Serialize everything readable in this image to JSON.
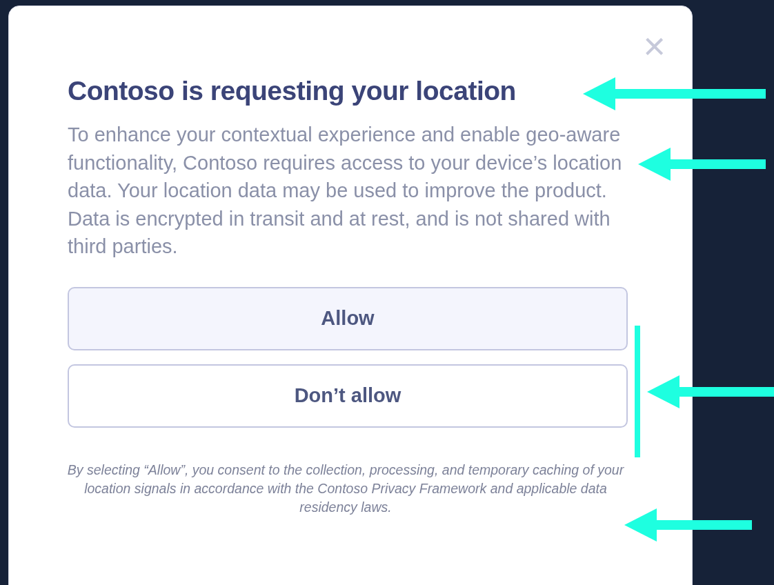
{
  "dialog": {
    "close": "×",
    "title": "Contoso is requesting your location",
    "body": "To enhance your contextual experience and enable geo-aware functionality, Contoso requires access to your device’s location data. Your location data may be used to improve the product. Data is encrypted in transit and at rest, and is not shared with third parties.",
    "buttons": [
      {
        "label": "Allow",
        "kind": "primary"
      },
      {
        "label": "Don’t allow",
        "kind": "secondary"
      }
    ],
    "footnote": "By selecting “Allow”, you consent to the collection, processing, and temporary caching of your location signals in accordance with the Contoso Privacy Framework and applicable data residency laws."
  }
}
